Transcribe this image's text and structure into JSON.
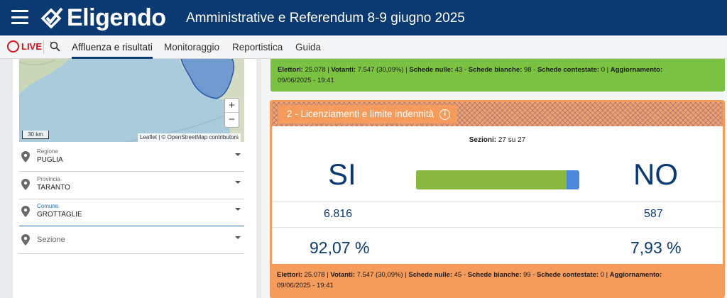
{
  "header": {
    "logo_text": "Eligendo",
    "title": "Amministrative e Referendum 8-9 giugno 2025",
    "menu_icon": "hamburger-icon",
    "colors": {
      "brand": "#0b3a73",
      "live": "#d0161b"
    }
  },
  "nav": {
    "live_label": "LIVE",
    "search_icon": "search-icon",
    "tabs": [
      {
        "label": "Affluenza e risultati",
        "active": true
      },
      {
        "label": "Monitoraggio",
        "active": false
      },
      {
        "label": "Reportistica",
        "active": false
      },
      {
        "label": "Guida",
        "active": false
      }
    ]
  },
  "map": {
    "zoom_in": "+",
    "zoom_out": "−",
    "scale": "30 km",
    "attribution": "Leaflet | © OpenStreetMap contributors"
  },
  "filters": [
    {
      "label": "Regione",
      "value": "PUGLIA"
    },
    {
      "label": "Provincia",
      "value": "TARANTO"
    },
    {
      "label": "Comune",
      "value": "GROTTAGLIE"
    },
    {
      "placeholder": "Sezione"
    }
  ],
  "card1": {
    "color": "#7cc242",
    "elettori_label": "Elettori:",
    "elettori": "25.078",
    "votanti_label": "Votanti:",
    "votanti": "7.547 (30,09%)",
    "nulle_label": "Schede nulle:",
    "nulle": "43",
    "bianche_label": "Schede bianche:",
    "bianche": "98",
    "contestate_label": "Schede contestate:",
    "contestate": "0",
    "aggiornamento_label": "Aggiornamento:",
    "aggiornamento": "09/06/2025 - 19:41"
  },
  "card2": {
    "color": "#f59b5c",
    "title": "2 - Licenziamenti e limite indennità",
    "info_icon": "info-icon",
    "sezioni_label": "Sezioni:",
    "sezioni": "27 su 27",
    "si_label": "SI",
    "no_label": "NO",
    "si_votes": "6.816",
    "no_votes": "587",
    "si_pct": "92,07 %",
    "no_pct": "7,93 %",
    "si_fraction": 0.9207,
    "bar_colors": {
      "si": "#8ab73f",
      "no": "#4a89dc"
    },
    "elettori_label": "Elettori:",
    "elettori": "25.078",
    "votanti_label": "Votanti:",
    "votanti": "7.547 (30,09%)",
    "nulle_label": "Schede nulle:",
    "nulle": "45",
    "bianche_label": "Schede bianche:",
    "bianche": "99",
    "contestate_label": "Schede contestate:",
    "contestate": "0",
    "aggiornamento_label": "Aggiornamento:",
    "aggiornamento": "09/06/2025 - 19:41"
  }
}
